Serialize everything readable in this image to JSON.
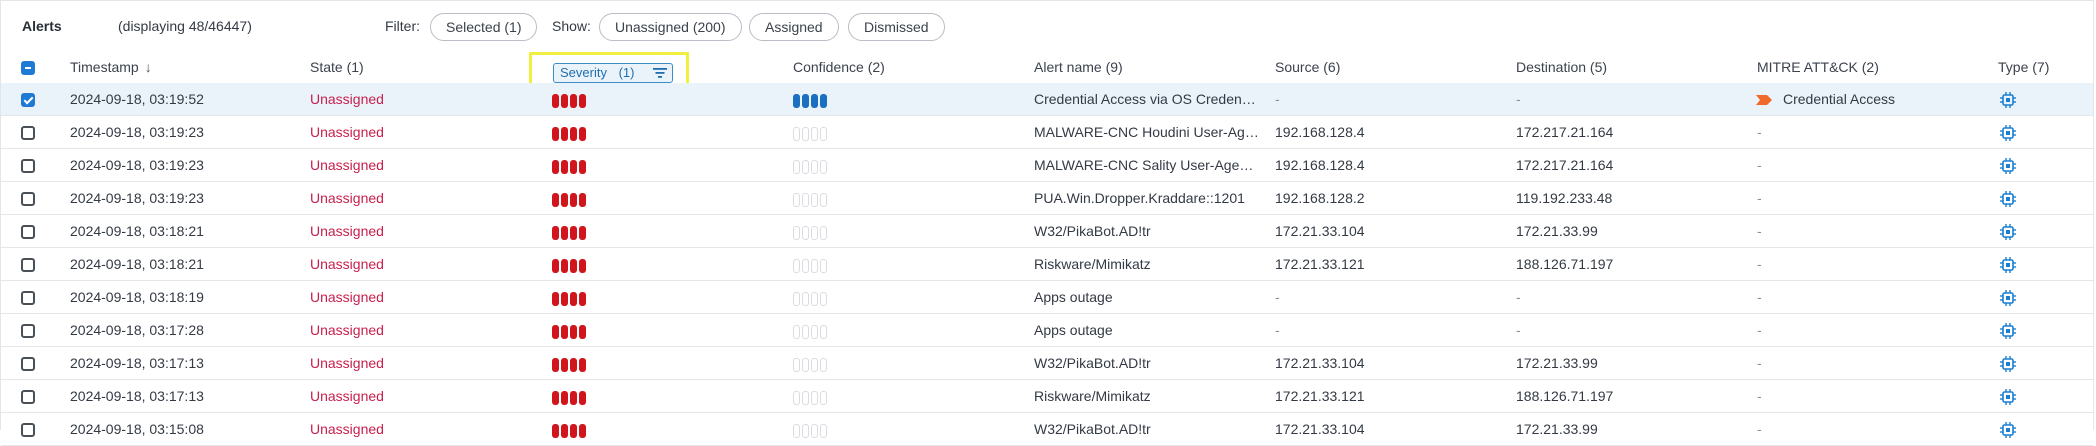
{
  "toolbar": {
    "title": "Alerts",
    "count": "(displaying 48/46447)",
    "filter_label": "Filter:",
    "filter_selected": "Selected (1)",
    "show_label": "Show:",
    "show_unassigned": "Unassigned (200)",
    "show_assigned": "Assigned",
    "show_dismissed": "Dismissed"
  },
  "columns": {
    "timestamp": "Timestamp",
    "state": "State (1)",
    "severity": "Severity",
    "severity_count": "(1)",
    "confidence": "Confidence (2)",
    "alert_name": "Alert name (9)",
    "source": "Source (6)",
    "destination": "Destination (5)",
    "mitre": "MITRE ATT&CK (2)",
    "type": "Type (7)"
  },
  "colors": {
    "severity": "#d0161c",
    "confidence": "#1a6fc1",
    "state": "#c8204e",
    "accent": "#1f7ad4",
    "mitre": "#f06a2a",
    "highlight": "#f0ef3f"
  },
  "rows": [
    {
      "selected": true,
      "timestamp": "2024-09-18, 03:19:52",
      "state": "Unassigned",
      "severity": 4,
      "confidence": 4,
      "alert_name": "Credential Access via OS Credent…",
      "source": "-",
      "destination": "-",
      "mitre": "Credential Access",
      "type_icon": "chip-icon"
    },
    {
      "selected": false,
      "timestamp": "2024-09-18, 03:19:23",
      "state": "Unassigned",
      "severity": 4,
      "confidence": 0,
      "alert_name": "MALWARE-CNC Houdini User-Ag…",
      "source": "192.168.128.4",
      "destination": "172.217.21.164",
      "mitre": "-",
      "type_icon": "chip-icon"
    },
    {
      "selected": false,
      "timestamp": "2024-09-18, 03:19:23",
      "state": "Unassigned",
      "severity": 4,
      "confidence": 0,
      "alert_name": "MALWARE-CNC Sality User-Agen…",
      "source": "192.168.128.4",
      "destination": "172.217.21.164",
      "mitre": "-",
      "type_icon": "chip-icon"
    },
    {
      "selected": false,
      "timestamp": "2024-09-18, 03:19:23",
      "state": "Unassigned",
      "severity": 4,
      "confidence": 0,
      "alert_name": "PUA.Win.Dropper.Kraddare::1201",
      "source": "192.168.128.2",
      "destination": "119.192.233.48",
      "mitre": "-",
      "type_icon": "chip-icon"
    },
    {
      "selected": false,
      "timestamp": "2024-09-18, 03:18:21",
      "state": "Unassigned",
      "severity": 4,
      "confidence": 0,
      "alert_name": "W32/PikaBot.AD!tr",
      "source": "172.21.33.104",
      "destination": "172.21.33.99",
      "mitre": "-",
      "type_icon": "chip-icon"
    },
    {
      "selected": false,
      "timestamp": "2024-09-18, 03:18:21",
      "state": "Unassigned",
      "severity": 4,
      "confidence": 0,
      "alert_name": "Riskware/Mimikatz",
      "source": "172.21.33.121",
      "destination": "188.126.71.197",
      "mitre": "-",
      "type_icon": "chip-icon"
    },
    {
      "selected": false,
      "timestamp": "2024-09-18, 03:18:19",
      "state": "Unassigned",
      "severity": 4,
      "confidence": 0,
      "alert_name": "Apps outage",
      "source": "-",
      "destination": "-",
      "mitre": "-",
      "type_icon": "chip-icon"
    },
    {
      "selected": false,
      "timestamp": "2024-09-18, 03:17:28",
      "state": "Unassigned",
      "severity": 4,
      "confidence": 0,
      "alert_name": "Apps outage",
      "source": "-",
      "destination": "-",
      "mitre": "-",
      "type_icon": "chip-icon"
    },
    {
      "selected": false,
      "timestamp": "2024-09-18, 03:17:13",
      "state": "Unassigned",
      "severity": 4,
      "confidence": 0,
      "alert_name": "W32/PikaBot.AD!tr",
      "source": "172.21.33.104",
      "destination": "172.21.33.99",
      "mitre": "-",
      "type_icon": "chip-icon"
    },
    {
      "selected": false,
      "timestamp": "2024-09-18, 03:17:13",
      "state": "Unassigned",
      "severity": 4,
      "confidence": 0,
      "alert_name": "Riskware/Mimikatz",
      "source": "172.21.33.121",
      "destination": "188.126.71.197",
      "mitre": "-",
      "type_icon": "chip-icon"
    },
    {
      "selected": false,
      "timestamp": "2024-09-18, 03:15:08",
      "state": "Unassigned",
      "severity": 4,
      "confidence": 0,
      "alert_name": "W32/PikaBot.AD!tr",
      "source": "172.21.33.104",
      "destination": "172.21.33.99",
      "mitre": "-",
      "type_icon": "chip-icon"
    }
  ]
}
